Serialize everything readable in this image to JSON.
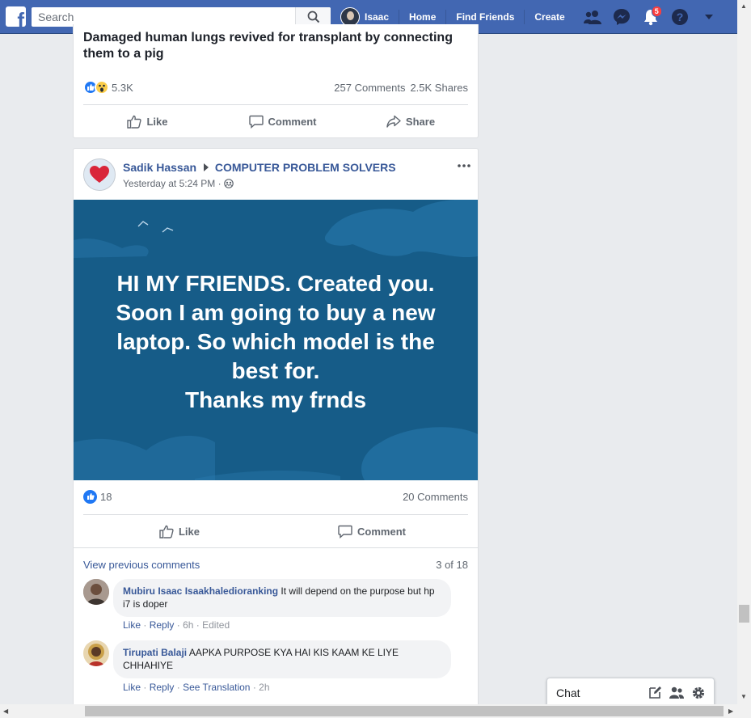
{
  "topbar": {
    "logo": "f",
    "search_placeholder": "Search",
    "profile_name": "Isaac",
    "links": [
      "Home",
      "Find Friends",
      "Create"
    ],
    "notifications_count": "5",
    "icons": [
      "friends-icon",
      "messenger-icon",
      "notifications-icon",
      "help-icon",
      "dropdown-icon"
    ]
  },
  "post1": {
    "headline": "Damaged human lungs revived for transplant by connecting them to a pig",
    "reaction_count": "5.3K",
    "comments": "257 Comments",
    "shares": "2.5K Shares",
    "actions": {
      "like": "Like",
      "comment": "Comment",
      "share": "Share"
    }
  },
  "post2": {
    "author": "Sadik Hassan",
    "group": "COMPUTER PROBLEM SOLVERS",
    "time": "Yesterday at 5:24 PM ·",
    "image_text_lines": [
      "HI MY FRIENDS. Created you.",
      "Soon I am going to buy a new",
      "laptop. So which model is the",
      "best for.",
      "Thanks my frnds"
    ],
    "reaction_count": "18",
    "comments": "20 Comments",
    "actions": {
      "like": "Like",
      "comment": "Comment"
    },
    "view_previous": "View previous comments",
    "comment_position": "3 of 18",
    "comment_list": [
      {
        "name": "Mubiru Isaac Isaakhaledioranking",
        "text": " It will depend on the purpose but hp i7 is doper",
        "actions": [
          "Like",
          "Reply",
          "6h",
          "Edited"
        ]
      },
      {
        "name": "Tirupati Balaji",
        "text": " AAPKA PURPOSE KYA HAI KIS KAAM KE LIYE CHHAHIYE",
        "actions": [
          "Like",
          "Reply",
          "See Translation",
          "2h"
        ]
      }
    ]
  },
  "chat": {
    "label": "Chat"
  },
  "colors": {
    "brand": "#4267b2",
    "link": "#385898",
    "image_bg": "#165c88",
    "badge": "#fa3e3e"
  }
}
